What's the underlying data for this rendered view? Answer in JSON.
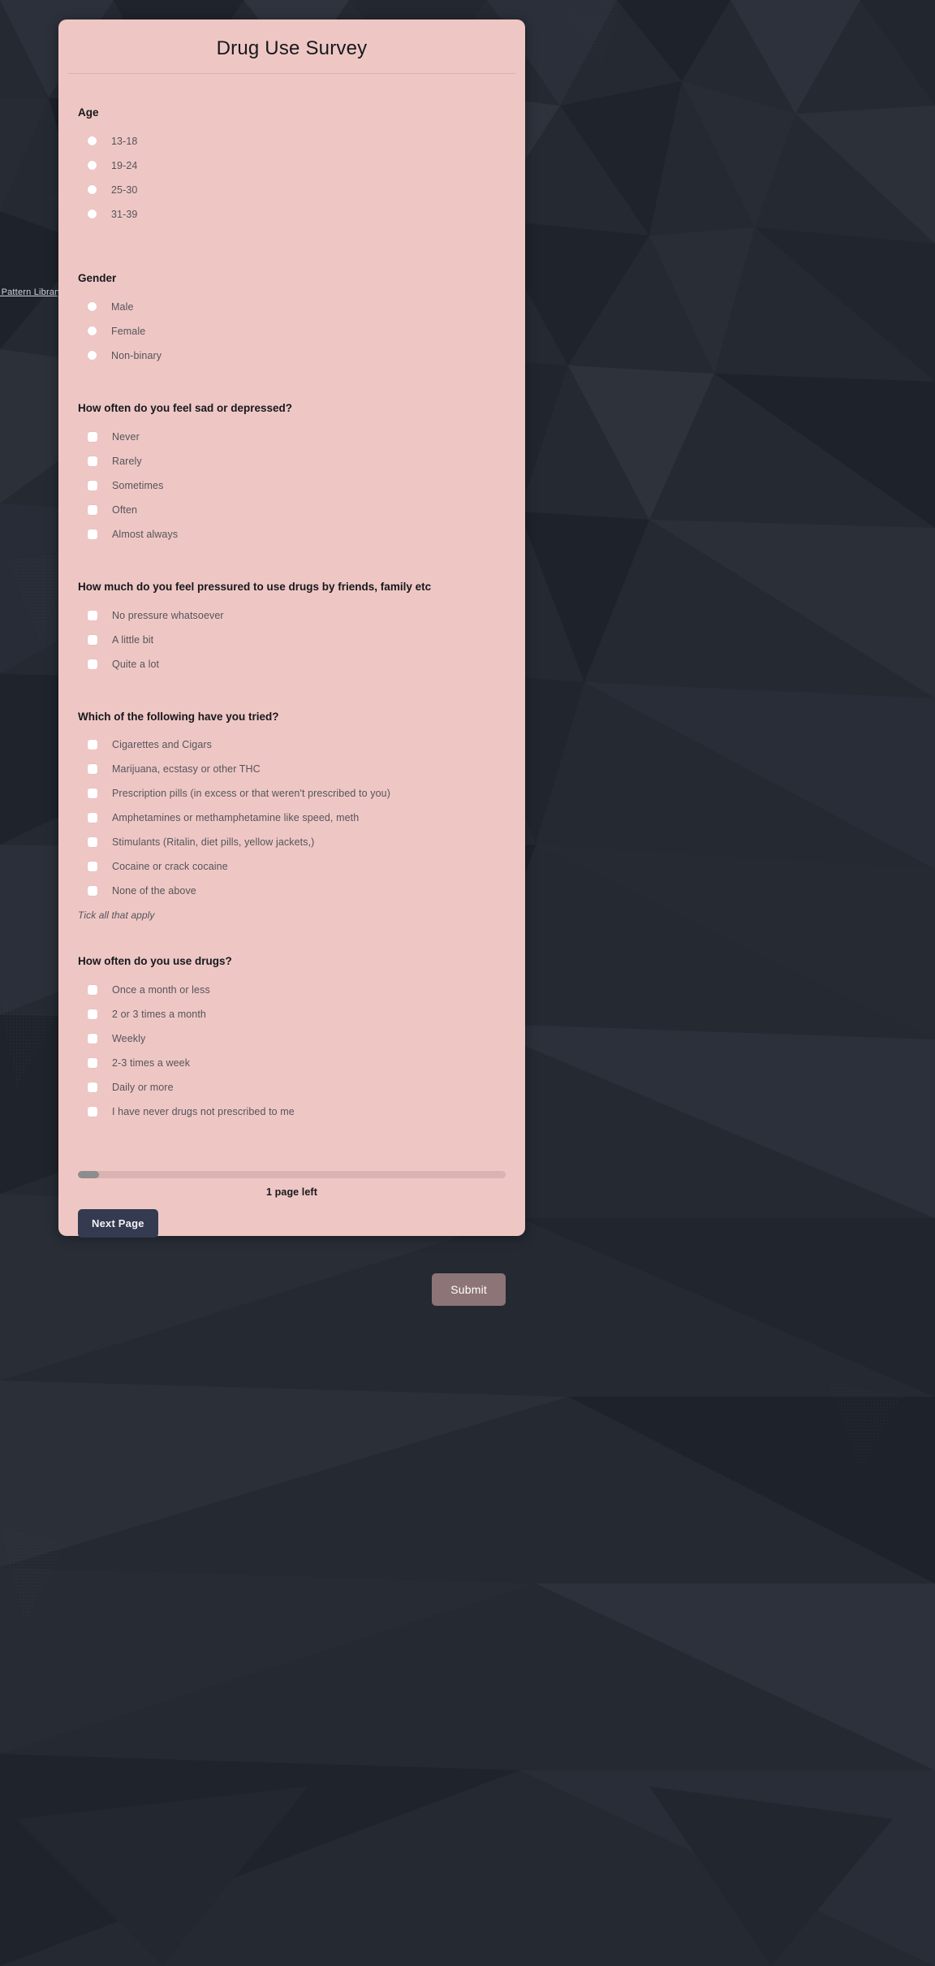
{
  "background": {
    "credit_link": "e Pattern Library",
    "color": "#252932"
  },
  "card": {
    "title": "Drug Use Survey",
    "background_color": "#eec7c5"
  },
  "questions": [
    {
      "label": "Age",
      "input_type": "radio",
      "options": [
        "13-18",
        "19-24",
        "25-30",
        "31-39"
      ]
    },
    {
      "label": "Gender",
      "input_type": "radio",
      "options": [
        "Male",
        "Female",
        "Non-binary"
      ]
    },
    {
      "label": "How often do you feel sad or depressed?",
      "input_type": "checkbox",
      "options": [
        "Never",
        "Rarely",
        "Sometimes",
        "Often",
        "Almost always"
      ]
    },
    {
      "label": "How much do you feel pressured to use drugs by friends, family etc",
      "input_type": "checkbox",
      "options": [
        "No pressure whatsoever",
        "A little bit",
        "Quite a lot"
      ]
    },
    {
      "label": "Which of the following have you tried?",
      "input_type": "checkbox",
      "options": [
        "Cigarettes and Cigars",
        "Marijuana, ecstasy or other THC",
        "Prescription pills (in excess or that weren't prescribed to you)",
        "Amphetamines or methamphetamine like speed, meth",
        "Stimulants (Ritalin, diet pills, yellow jackets,)",
        "Cocaine or crack cocaine",
        "None of the above"
      ],
      "helper": "Tick all that apply"
    },
    {
      "label": "How often do you use drugs?",
      "input_type": "checkbox",
      "options": [
        "Once a month or less",
        "2 or 3 times a month",
        "Weekly",
        "2-3 times a week",
        "Daily or more",
        "I have never drugs not prescribed to me"
      ]
    }
  ],
  "footer": {
    "progress_percent": 5,
    "pages_left_label": "1 page left",
    "next_page_label": "Next Page",
    "submit_label": "Submit",
    "next_page_color": "#343a4f",
    "submit_color": "#8d7476",
    "progress_fill_color": "#8d8d8d",
    "progress_track_color": "#d8b3b1"
  }
}
